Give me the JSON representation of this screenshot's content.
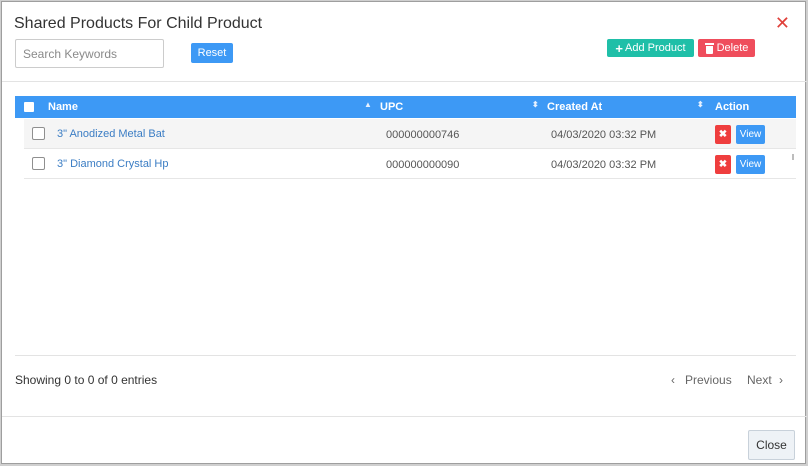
{
  "dialog": {
    "title": "Shared Products For Child Product",
    "close_symbol": "✕"
  },
  "toolbar": {
    "search_placeholder": "Search Keywords",
    "search_value": "",
    "reset_label": "Reset",
    "add_label": "Add Product",
    "delete_label": "Delete",
    "add_color": "#1fbfa8",
    "delete_color": "#ef4d5c",
    "accent_color": "#3d99f5"
  },
  "table": {
    "columns": [
      "Name",
      "UPC",
      "Created At",
      "Action"
    ],
    "rows": [
      {
        "name": "3\" Anodized Metal Bat",
        "upc": "000000000746",
        "created_at": "04/03/2020 03:32 PM",
        "remove_symbol": "✖",
        "view_label": "View"
      },
      {
        "name": "3\" Diamond Crystal Hp",
        "upc": "000000000090",
        "created_at": "04/03/2020 03:32 PM",
        "remove_symbol": "✖",
        "view_label": "View"
      }
    ]
  },
  "footer": {
    "info": "Showing 0 to 0 of 0 entries",
    "previous_label": "Previous",
    "next_label": "Next",
    "close_label": "Close"
  }
}
